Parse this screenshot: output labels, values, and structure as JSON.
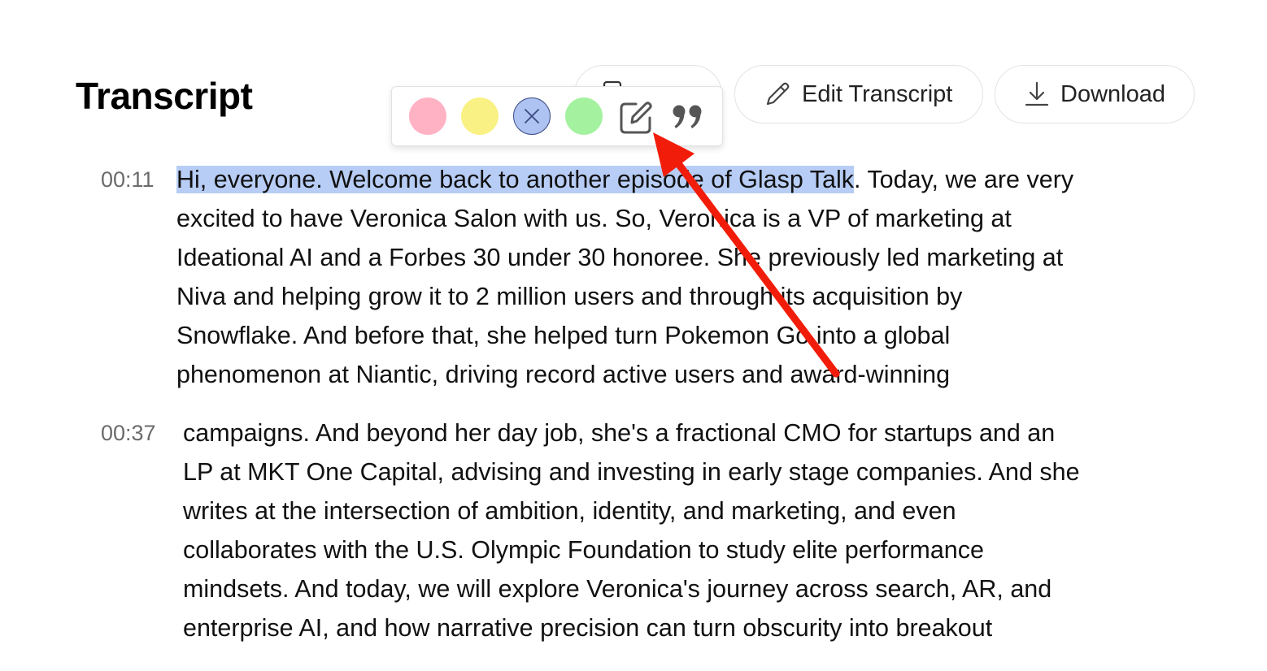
{
  "header": {
    "title": "Transcript",
    "buttons": [
      {
        "label": "",
        "icon": "copy-icon"
      },
      {
        "label": "Edit Transcript",
        "icon": "pencil-icon"
      },
      {
        "label": "Download",
        "icon": "download-icon"
      }
    ]
  },
  "highlight_toolbar": {
    "colors": [
      {
        "name": "pink",
        "hex": "#ffb2c4"
      },
      {
        "name": "yellow",
        "hex": "#f9f183"
      },
      {
        "name": "blue",
        "hex": "#aec3f2",
        "selected": true,
        "icon": "close-icon"
      },
      {
        "name": "green",
        "hex": "#a4f2a0"
      }
    ],
    "actions": [
      {
        "icon": "edit-note-icon"
      },
      {
        "icon": "quote-icon"
      }
    ]
  },
  "segments": [
    {
      "timestamp": "00:11",
      "highlighted_text": "Hi, everyone. Welcome back to another episode of Glasp Talk",
      "lines": [
        ". Today, we are very",
        "excited to have Veronica Salon with us. So, Veronica is a VP of marketing at",
        "Ideational AI and a Forbes 30 under 30 honoree. She previously led marketing at",
        "Niva and helping grow it to 2 million users and through its acquisition by",
        "Snowflake. And before that, she helped turn Pokemon Go into a global",
        "phenomenon at Niantic, driving record active users and award-winning"
      ]
    },
    {
      "timestamp": "00:37",
      "lines": [
        "campaigns. And beyond her day job, she's a fractional CMO for startups and an",
        "LP at MKT One Capital, advising and investing in early stage companies. And she",
        "writes at the intersection of ambition, identity, and marketing, and even",
        "collaborates with the U.S. Olympic Foundation to study elite performance",
        "mindsets. And today, we will explore Veronica's journey across search, AR, and",
        "enterprise AI, and how narrative precision can turn obscurity into breakout"
      ]
    }
  ],
  "annotation": {
    "type": "arrow",
    "color": "#f21c0a"
  }
}
